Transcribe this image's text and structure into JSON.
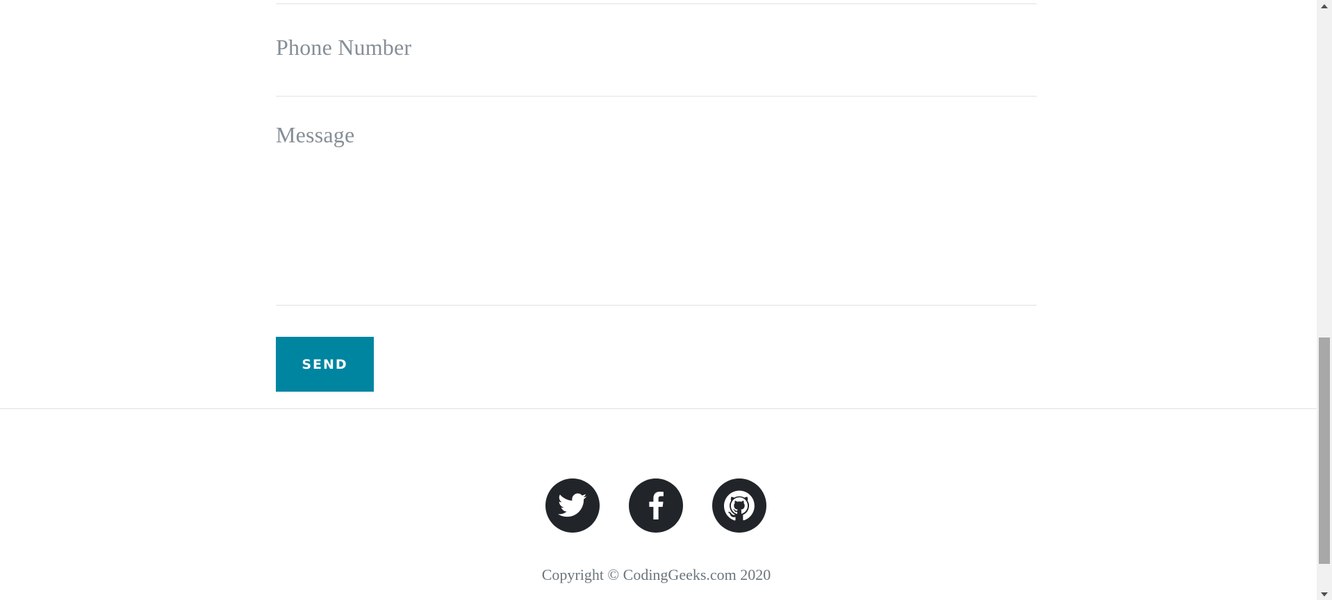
{
  "form": {
    "phone_placeholder": "Phone Number",
    "message_placeholder": "Message",
    "send_label": "SEND"
  },
  "footer": {
    "social": [
      {
        "icon": "twitter-icon"
      },
      {
        "icon": "facebook-icon"
      },
      {
        "icon": "github-icon"
      }
    ],
    "copyright": "Copyright © CodingGeeks.com 2020"
  },
  "colors": {
    "accent": "#0085a1",
    "social_bg": "#212529",
    "placeholder": "#868e96",
    "divider": "#dee2e6"
  },
  "scrollbar": {
    "position_percent": 100
  }
}
